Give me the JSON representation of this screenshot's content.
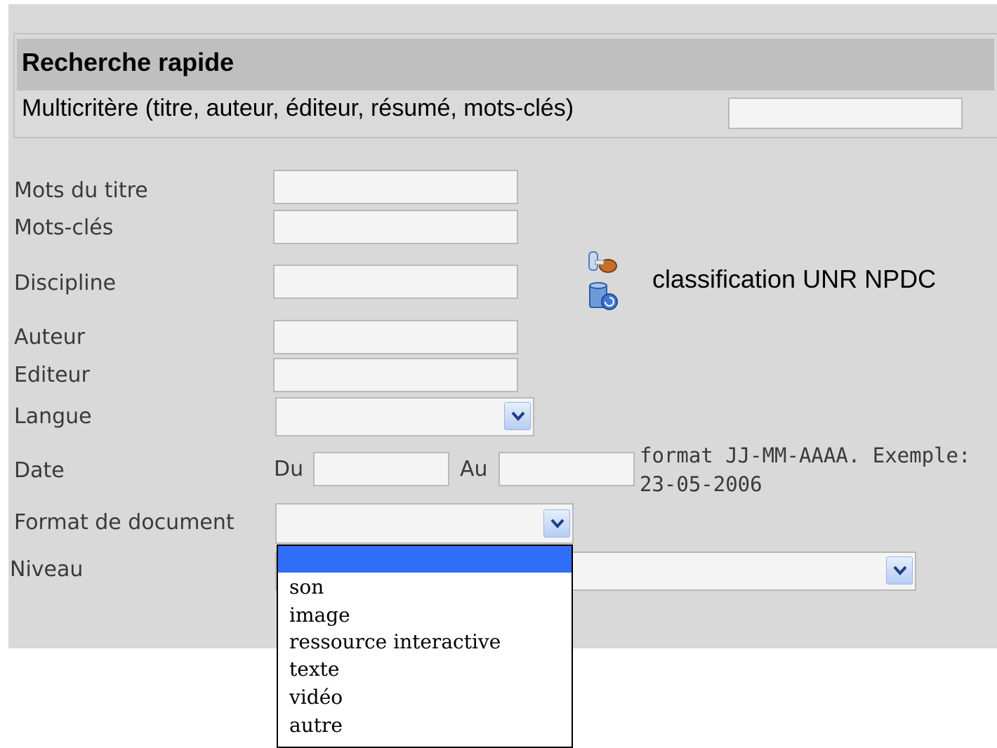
{
  "quick_search": {
    "title": "Recherche rapide",
    "multicriteria_label": "Multicritère (titre, auteur, éditeur, résumé, mots-clés)",
    "multicriteria_value": ""
  },
  "form": {
    "title_words": {
      "label": "Mots du titre",
      "value": ""
    },
    "keywords": {
      "label": "Mots-clés",
      "value": ""
    },
    "discipline": {
      "label": "Discipline",
      "value": ""
    },
    "author": {
      "label": "Auteur",
      "value": ""
    },
    "publisher": {
      "label": "Editeur",
      "value": ""
    },
    "language": {
      "label": "Langue",
      "value": ""
    },
    "date": {
      "label": "Date",
      "from_label": "Du",
      "to_label": "Au",
      "from_value": "",
      "to_value": "",
      "hint_line1": "format JJ-MM-AAAA. Exemple:",
      "hint_line2": "23-05-2006"
    },
    "document_format": {
      "label": "Format de document",
      "value": "",
      "options": [
        "",
        "son",
        "image",
        "ressource interactive",
        "texte",
        "vidéo",
        "autre"
      ]
    },
    "level": {
      "label": "Niveau",
      "value": ""
    }
  },
  "classification": {
    "text": "classification UNR NPDC",
    "icons": [
      "tree-browse-icon",
      "database-icon"
    ]
  },
  "colors": {
    "panel_bg": "#d9d9d9",
    "header_bg": "#bfbfbf",
    "selected_option_bg": "#316ef7"
  }
}
